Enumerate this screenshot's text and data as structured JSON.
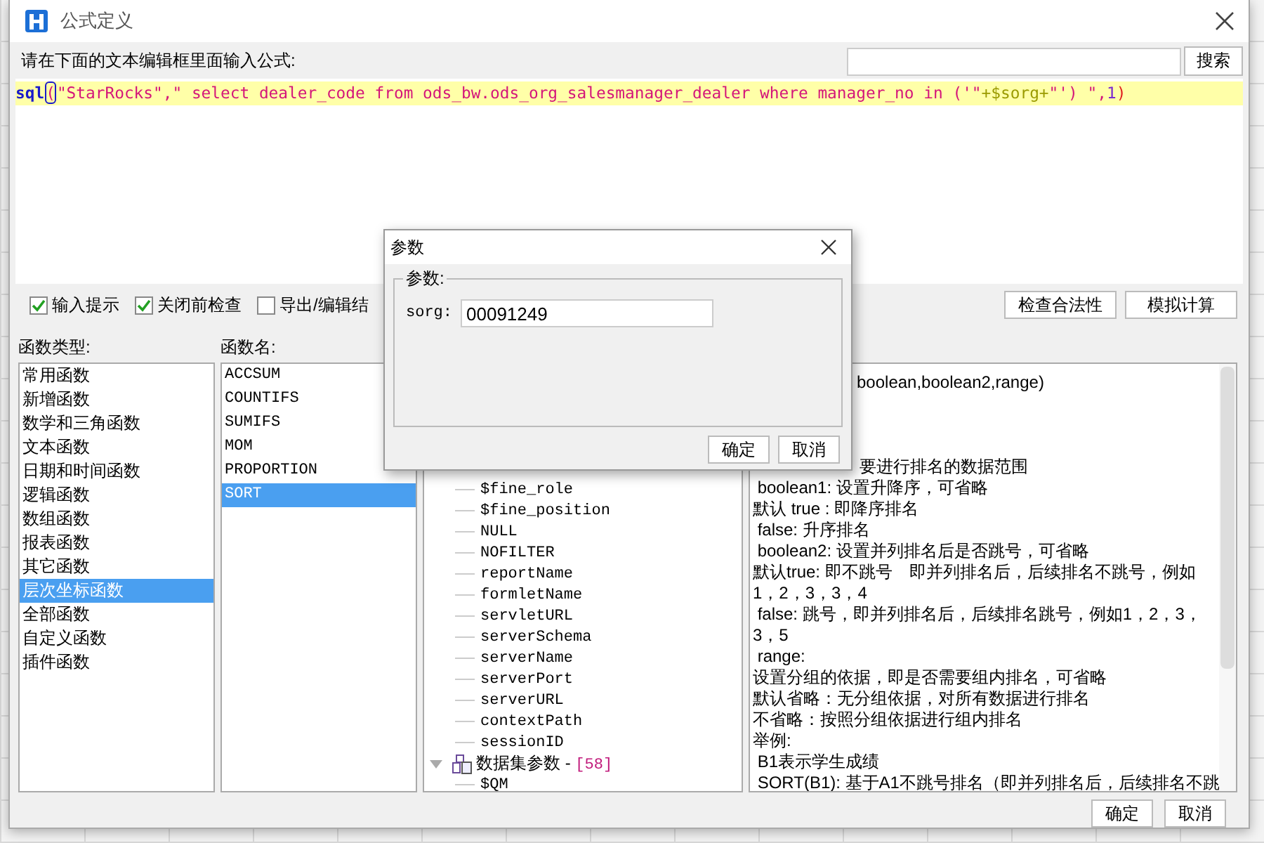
{
  "window": {
    "title": "公式定义"
  },
  "prompt": "请在下面的文本编辑框里面输入公式:",
  "search": {
    "button": "搜索"
  },
  "formula": [
    {
      "text": "sql",
      "kind": "keyword"
    },
    {
      "text": "(",
      "kind": "bracket-match"
    },
    {
      "text": "\"StarRocks\",\" select dealer_code from ods_bw.ods_org_salesmanager_dealer where manager_no in ('\"",
      "kind": "string"
    },
    {
      "text": "+$sorg+",
      "kind": "variable"
    },
    {
      "text": "\"') \",",
      "kind": "string"
    },
    {
      "text": "1",
      "kind": "number"
    },
    {
      "text": ")",
      "kind": "bracket"
    }
  ],
  "options": [
    {
      "label": "输入提示",
      "checked": true
    },
    {
      "label": "关闭前检查",
      "checked": true
    },
    {
      "label": "导出/编辑结",
      "checked": false
    }
  ],
  "actions": [
    "检查合法性",
    "模拟计算"
  ],
  "function_types": {
    "label": "函数类型:",
    "items": [
      {
        "label": "常用函数",
        "selected": false
      },
      {
        "label": "新增函数",
        "selected": false
      },
      {
        "label": "数学和三角函数",
        "selected": false
      },
      {
        "label": "文本函数",
        "selected": false
      },
      {
        "label": "日期和时间函数",
        "selected": false
      },
      {
        "label": "逻辑函数",
        "selected": false
      },
      {
        "label": "数组函数",
        "selected": false
      },
      {
        "label": "报表函数",
        "selected": false
      },
      {
        "label": "其它函数",
        "selected": false
      },
      {
        "label": "层次坐标函数",
        "selected": true
      },
      {
        "label": "全部函数",
        "selected": false
      },
      {
        "label": "自定义函数",
        "selected": false
      },
      {
        "label": "插件函数",
        "selected": false
      }
    ]
  },
  "function_names": {
    "label": "函数名:",
    "items": [
      {
        "label": "ACCSUM",
        "selected": false
      },
      {
        "label": "COUNTIFS",
        "selected": false
      },
      {
        "label": "SUMIFS",
        "selected": false
      },
      {
        "label": "MOM",
        "selected": false
      },
      {
        "label": "PROPORTION",
        "selected": false
      },
      {
        "label": "SORT",
        "selected": true
      }
    ]
  },
  "tree": [
    {
      "label": "$fine_role"
    },
    {
      "label": "$fine_position"
    },
    {
      "label": "NULL"
    },
    {
      "label": "NOFILTER"
    },
    {
      "label": "reportName"
    },
    {
      "label": "formletName"
    },
    {
      "label": "servletURL"
    },
    {
      "label": "serverSchema"
    },
    {
      "label": "serverName"
    },
    {
      "label": "serverPort"
    },
    {
      "label": "serverURL"
    },
    {
      "label": "contextPath"
    },
    {
      "label": "sessionID"
    },
    {
      "label": "数据集参数 - ",
      "count": "[58]",
      "expanded": true,
      "children": [
        {
          "label": "$QM"
        }
      ]
    }
  ],
  "description": [
    {
      "text": "boolean,boolean2,range)",
      "kind": "partial"
    },
    {
      "text": "要进行排名的数据范围",
      "kind": "partial-gap"
    },
    {
      "text": " boolean1: 设置升降序，可省略",
      "kind": "line"
    },
    {
      "text": "默认 true : 即降序排名",
      "kind": "line"
    },
    {
      "text": " false: 升序排名",
      "kind": "line"
    },
    {
      "text": " boolean2: 设置并列排名后是否跳号，可省略",
      "kind": "line"
    },
    {
      "text": "默认true: 即不跳号　即并列排名后，后续排名不跳号，例如",
      "kind": "line"
    },
    {
      "text": "1，2，3，3，4",
      "kind": "line"
    },
    {
      "text": " false: 跳号，即并列排名后，后续排名跳号，例如1，2，3，",
      "kind": "line"
    },
    {
      "text": "3，5",
      "kind": "line"
    },
    {
      "text": " range:",
      "kind": "line"
    },
    {
      "text": "设置分组的依据，即是否需要组内排名，可省略",
      "kind": "line"
    },
    {
      "text": "默认省略：无分组依据，对所有数据进行排名",
      "kind": "line"
    },
    {
      "text": "不省略：按照分组依据进行组内排名",
      "kind": "line"
    },
    {
      "text": "举例:",
      "kind": "line"
    },
    {
      "text": " B1表示学生成绩",
      "kind": "line"
    },
    {
      "text": " SORT(B1): 基于A1不跳号排名（即并列排名后，后续排名不跳",
      "kind": "line"
    }
  ],
  "buttons": [
    "确定",
    "取消"
  ],
  "param_dialog": {
    "title": "参数",
    "group": "参数:",
    "field_label": "sorg:",
    "value": "00091249",
    "buttons": [
      "确定",
      "取消"
    ]
  }
}
